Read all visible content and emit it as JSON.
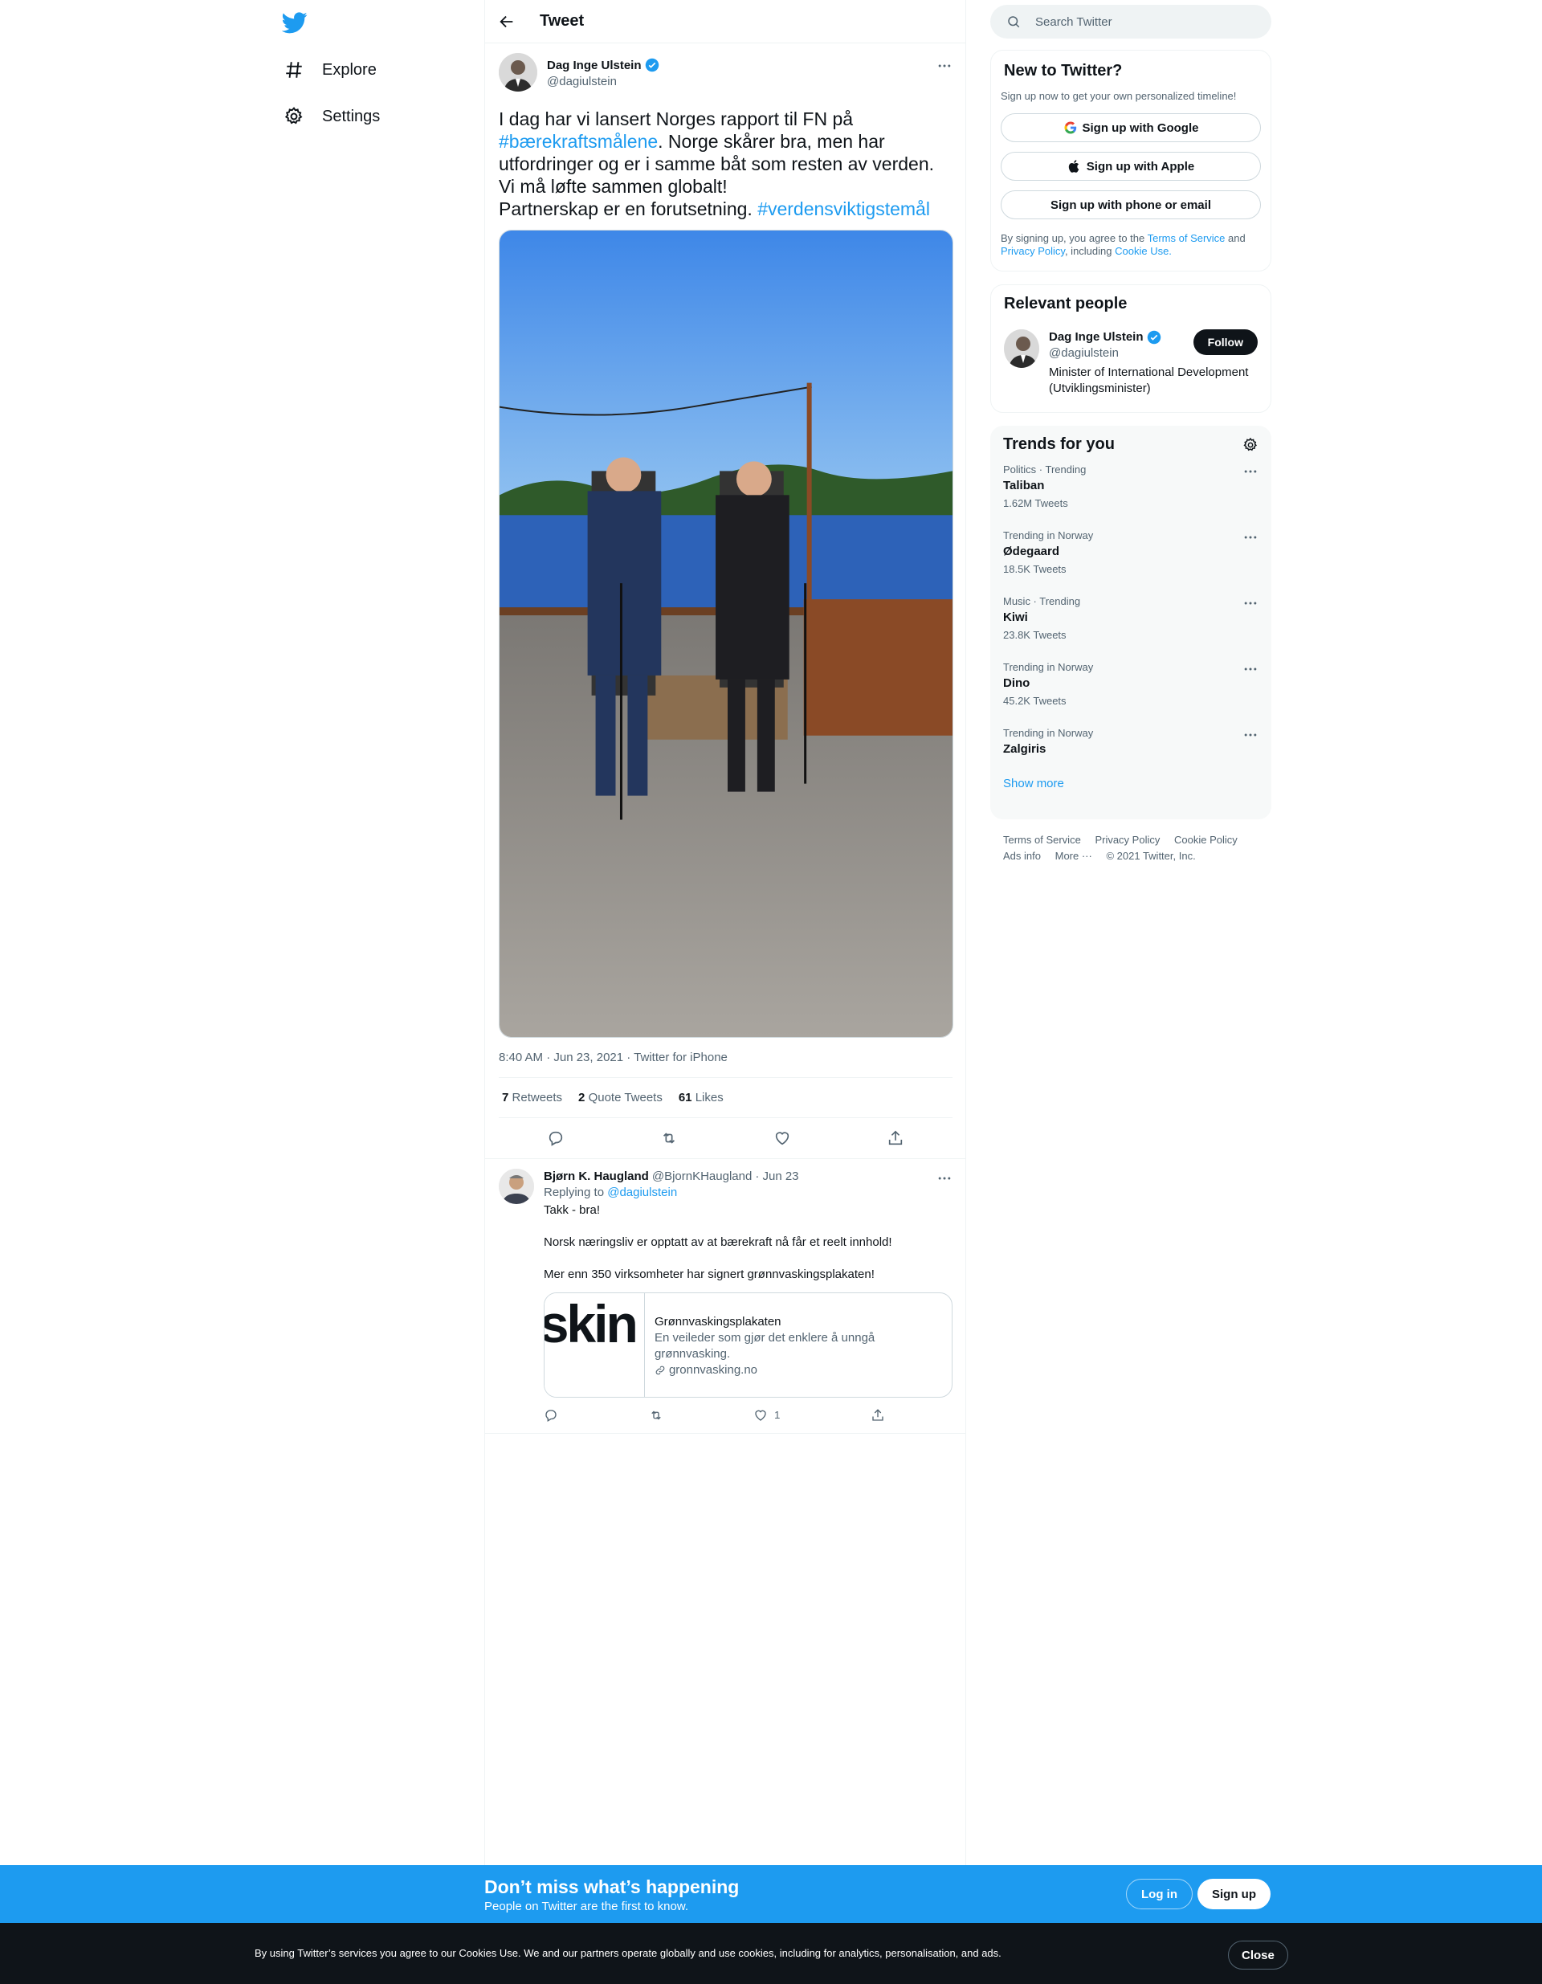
{
  "nav": {
    "items": [
      {
        "label": "Explore",
        "icon": "hashtag-icon"
      },
      {
        "label": "Settings",
        "icon": "gear-icon"
      }
    ]
  },
  "header": {
    "title": "Tweet"
  },
  "tweet": {
    "author_name": "Dag Inge Ulstein",
    "author_handle": "@dagiulstein",
    "text_part1": "I dag har vi lansert Norges rapport til FN på ",
    "hashtag1": "#bærekraftsmålene",
    "text_part2": ". Norge skårer bra, men har utfordringer og er i samme båt som resten av verden. Vi må løfte sammen globalt!\nPartnerskap er en forutsetning. ",
    "hashtag2": "#verdensviktigstemål",
    "meta": "8:40 AM · Jun 23, 2021 · Twitter for iPhone",
    "retweets_count": "7",
    "retweets_label": "Retweets",
    "quotes_count": "2",
    "quotes_label": "Quote Tweets",
    "likes_count": "61",
    "likes_label": "Likes"
  },
  "reply": {
    "author_name": "Bjørn K. Haugland",
    "author_handle": "@BjornKHaugland",
    "date": "· Jun 23",
    "replying_to_label": "Replying to",
    "replying_to_handle": "@dagiulstein",
    "text": "Takk - bra!\n\nNorsk næringsliv er opptatt av at bærekraft nå får et reelt innhold!\n\nMer enn 350 virksomheter har signert grønnvaskingsplakaten!",
    "card": {
      "thumb_text": "askin",
      "title": "Grønnvaskingsplakaten",
      "description": "En veileder som gjør det enklere å unngå grønnvasking.",
      "domain": "gronnvasking.no"
    },
    "likes": "1"
  },
  "search": {
    "placeholder": "Search Twitter"
  },
  "new_to_twitter": {
    "title": "New to Twitter?",
    "subtitle": "Sign up now to get your own personalized timeline!",
    "google": "Sign up with Google",
    "apple": "Sign up with Apple",
    "phone": "Sign up with phone or email",
    "legal_1": "By signing up, you agree to the ",
    "legal_tos": "Terms of Service",
    "legal_2": " and ",
    "legal_privacy": "Privacy Policy",
    "legal_3": ", including ",
    "legal_cookie": "Cookie Use."
  },
  "relevant": {
    "title": "Relevant people",
    "name": "Dag Inge Ulstein",
    "handle": "@dagiulstein",
    "bio": "Minister of International Development (Utviklingsminister)",
    "follow": "Follow"
  },
  "trends": {
    "title": "Trends for you",
    "items": [
      {
        "context": "Politics · Trending",
        "name": "Taliban",
        "count": "1.62M Tweets"
      },
      {
        "context": "Trending in Norway",
        "name": "Ødegaard",
        "count": "18.5K Tweets"
      },
      {
        "context": "Music · Trending",
        "name": "Kiwi",
        "count": "23.8K Tweets"
      },
      {
        "context": "Trending in Norway",
        "name": "Dino",
        "count": "45.2K Tweets"
      },
      {
        "context": "Trending in Norway",
        "name": "Zalgiris",
        "count": ""
      }
    ],
    "show_more": "Show more"
  },
  "footer": {
    "links": [
      "Terms of Service",
      "Privacy Policy",
      "Cookie Policy",
      "Ads info",
      "More ···",
      "© 2021 Twitter, Inc."
    ]
  },
  "banner": {
    "title": "Don’t miss what’s happening",
    "subtitle": "People on Twitter are the first to know.",
    "login": "Log in",
    "signup": "Sign up"
  },
  "cookie": {
    "text": "By using Twitter’s services you agree to our Cookies Use. We and our partners operate globally and use cookies, including for analytics, personalisation, and ads.",
    "close": "Close"
  },
  "colors": {
    "accent": "#1d9bf0",
    "text": "#0f1419",
    "muted": "#536471"
  }
}
